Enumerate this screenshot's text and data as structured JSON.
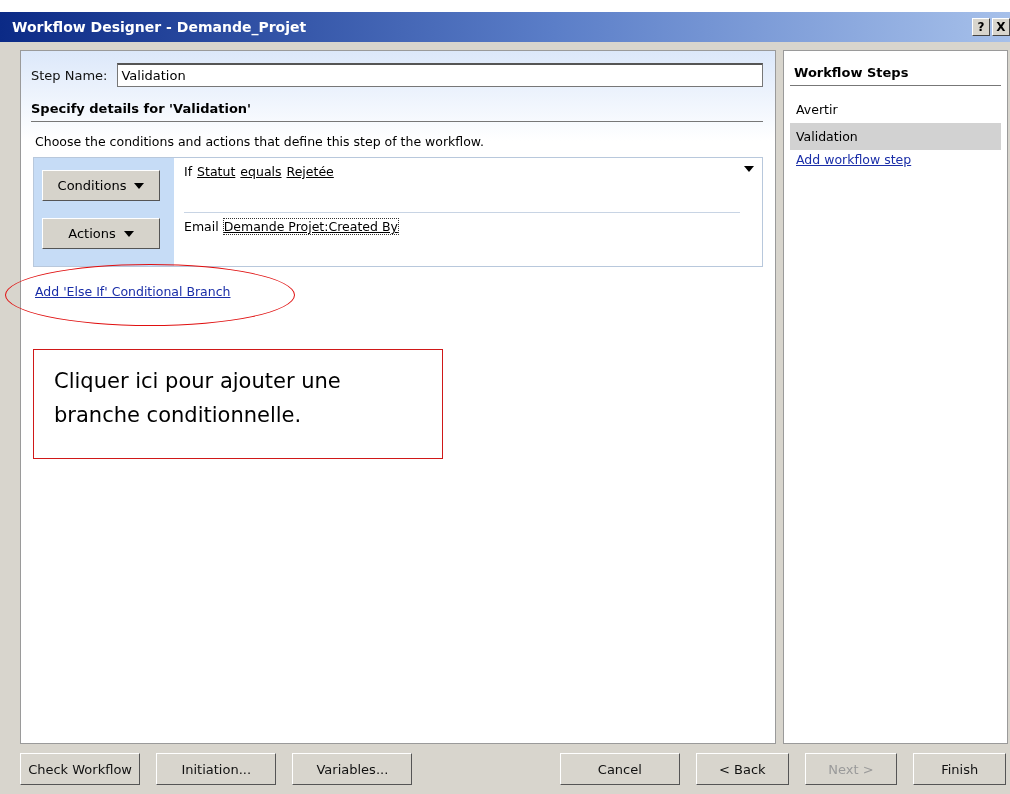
{
  "window": {
    "title": "Workflow Designer - Demande_Projet",
    "controls": [
      "?",
      "X"
    ]
  },
  "step_name": {
    "label": "Step Name:",
    "value": "Validation"
  },
  "details": {
    "heading": "Specify details for 'Validation'",
    "description": "Choose the conditions and actions that define this step of the workflow."
  },
  "rule": {
    "buttons": [
      "Conditions",
      "Actions"
    ],
    "condition": [
      {
        "kind": "text",
        "text": "If"
      },
      {
        "kind": "link",
        "text": "Statut"
      },
      {
        "kind": "link",
        "text": "equals"
      },
      {
        "kind": "link",
        "text": "Rejetée"
      }
    ],
    "action": [
      {
        "kind": "text",
        "text": "Email"
      },
      {
        "kind": "focus",
        "text": "Demande Projet:Created By"
      }
    ]
  },
  "else_if_link": "Add 'Else If' Conditional Branch",
  "annotation": "Cliquer ici pour ajouter une branche conditionnelle.",
  "workflow_steps": {
    "title": "Workflow Steps",
    "items": [
      {
        "label": "Avertir",
        "selected": false
      },
      {
        "label": "Validation",
        "selected": true
      }
    ],
    "add_link": "Add workflow step"
  },
  "buttons": [
    {
      "label": "Check Workflow",
      "disabled": false
    },
    {
      "label": "Initiation...",
      "disabled": false
    },
    {
      "label": "Variables...",
      "disabled": false
    },
    {
      "label": "Cancel",
      "disabled": false
    },
    {
      "label": "< Back",
      "disabled": false
    },
    {
      "label": "Next >",
      "disabled": true
    },
    {
      "label": "Finish",
      "disabled": false
    }
  ]
}
